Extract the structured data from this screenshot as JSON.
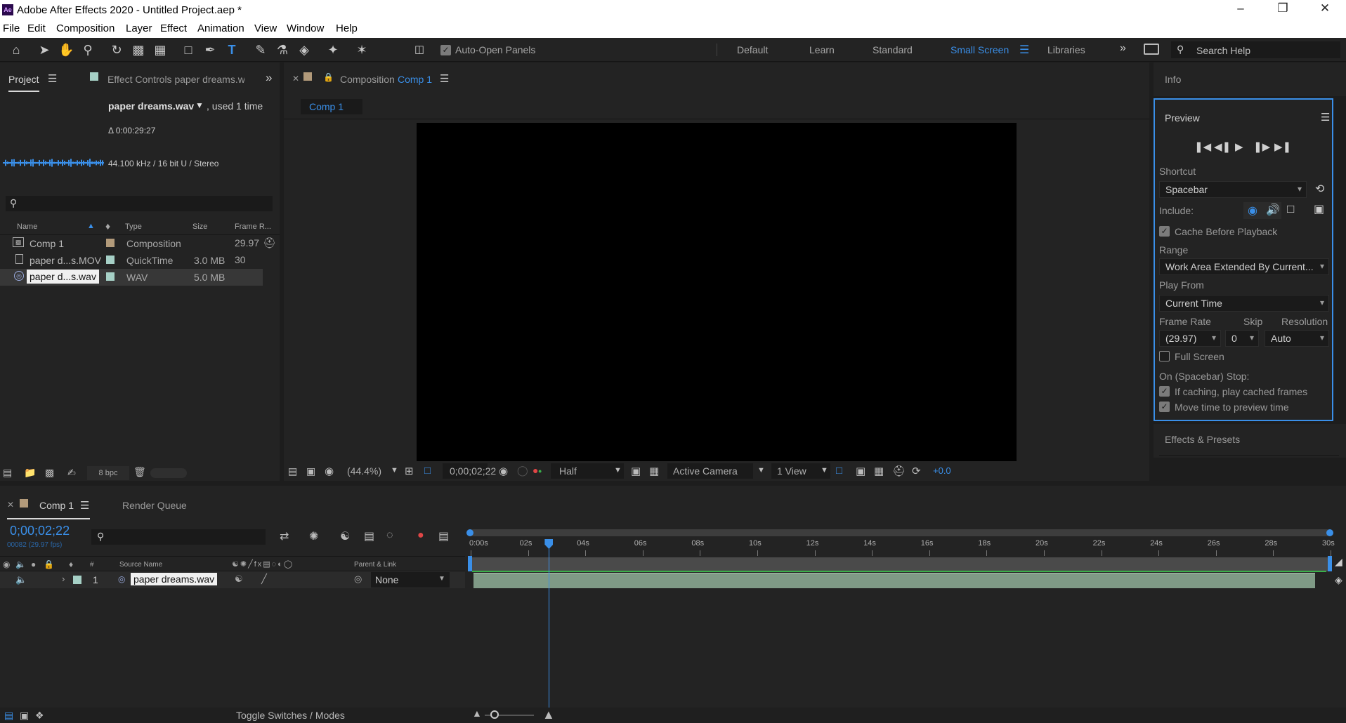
{
  "window": {
    "title": "Adobe After Effects 2020 - Untitled Project.aep *",
    "app_icon": "Ae"
  },
  "menu": [
    "File",
    "Edit",
    "Composition",
    "Layer",
    "Effect",
    "Animation",
    "View",
    "Window",
    "Help"
  ],
  "toolbar": {
    "auto_open": "Auto-Open Panels",
    "workspaces": [
      "Default",
      "Learn",
      "Standard",
      "Small Screen",
      "Libraries"
    ],
    "active_workspace": "Small Screen",
    "search_placeholder": "Search Help"
  },
  "project": {
    "tab": "Project",
    "effect_tab": "Effect Controls paper dreams.wa",
    "item_name": "paper dreams.wav",
    "item_used": ", used 1 time",
    "duration": "Δ 0:00:29:27",
    "audio_info": "44.100 kHz / 16 bit U / Stereo",
    "columns": [
      "Name",
      "Type",
      "Size",
      "Frame R..."
    ],
    "items": [
      {
        "name": "Comp 1",
        "type": "Composition",
        "size": "",
        "fps": "29.97",
        "color": "#b29a7a",
        "icon": "composition-icon"
      },
      {
        "name": "paper d...s.MOV",
        "type": "QuickTime",
        "size": "3.0 MB",
        "fps": "30",
        "color": "#a6d0c6",
        "icon": "footage-icon"
      },
      {
        "name": "paper d...s.wav",
        "type": "WAV",
        "size": "5.0 MB",
        "fps": "",
        "color": "#a6d0c6",
        "icon": "audio-file-icon"
      }
    ],
    "bpc": "8 bpc"
  },
  "composition": {
    "tab_prefix": "Composition",
    "tab_name": "Comp 1",
    "flow_tab": "Comp 1",
    "zoom": "(44.4%)",
    "timecode": "0;00;02;22",
    "resolution": "Half",
    "camera": "Active Camera",
    "views": "1 View",
    "exposure": "+0.0"
  },
  "info": {
    "tab": "Info"
  },
  "preview": {
    "title": "Preview",
    "shortcut_label": "Shortcut",
    "shortcut": "Spacebar",
    "include_label": "Include:",
    "cache_before": "Cache Before Playback",
    "range_label": "Range",
    "range": "Work Area Extended By Current...",
    "play_from_label": "Play From",
    "play_from": "Current Time",
    "frame_rate_label": "Frame Rate",
    "frame_rate": "(29.97)",
    "skip_label": "Skip",
    "skip": "0",
    "resolution_label": "Resolution",
    "resolution": "Auto",
    "full_screen": "Full Screen",
    "stop_label": "On (Spacebar) Stop:",
    "if_caching": "If caching, play cached frames",
    "move_time": "Move time to preview time"
  },
  "effects": {
    "tab": "Effects & Presets"
  },
  "timeline": {
    "tab": "Comp 1",
    "render_queue": "Render Queue",
    "timecode": "0;00;02;22",
    "frames": "00082 (29.97 fps)",
    "header": {
      "source": "Source Name",
      "parent": "Parent & Link",
      "num": "#"
    },
    "ruler": [
      "0:00s",
      "02s",
      "04s",
      "06s",
      "08s",
      "10s",
      "12s",
      "14s",
      "16s",
      "18s",
      "20s",
      "22s",
      "24s",
      "26s",
      "28s",
      "30s"
    ],
    "layer": {
      "num": "1",
      "name": "paper dreams.wav",
      "parent": "None"
    },
    "toggle": "Toggle Switches / Modes",
    "current_time_seconds": 2.73,
    "duration_seconds": 30
  }
}
